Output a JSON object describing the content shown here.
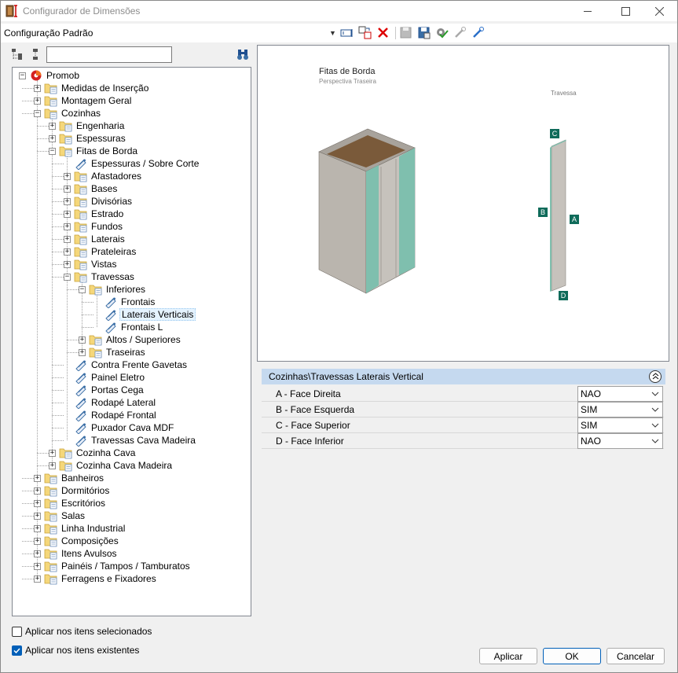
{
  "window": {
    "title": "Configurador de Dimensões"
  },
  "toolbar": {
    "configuration": "Configuração Padrão"
  },
  "search": {
    "value": ""
  },
  "tree": [
    {
      "label": "Promob",
      "depth": 0,
      "icon": "promob-icon",
      "expander": "minus"
    },
    {
      "label": "Medidas de Inserção",
      "depth": 1,
      "icon": "folder-icon",
      "expander": "plus"
    },
    {
      "label": "Montagem Geral",
      "depth": 1,
      "icon": "folder-icon",
      "expander": "plus"
    },
    {
      "label": "Cozinhas",
      "depth": 1,
      "icon": "folder-icon",
      "expander": "minus"
    },
    {
      "label": "Engenharia",
      "depth": 2,
      "icon": "folder-icon",
      "expander": "plus"
    },
    {
      "label": "Espessuras",
      "depth": 2,
      "icon": "folder-icon",
      "expander": "plus"
    },
    {
      "label": "Fitas de Borda",
      "depth": 2,
      "icon": "folder-icon",
      "expander": "minus"
    },
    {
      "label": "Espessuras / Sobre Corte",
      "depth": 3,
      "icon": "config-item-icon",
      "expander": "none"
    },
    {
      "label": "Afastadores",
      "depth": 3,
      "icon": "folder-icon",
      "expander": "plus"
    },
    {
      "label": "Bases",
      "depth": 3,
      "icon": "folder-icon",
      "expander": "plus"
    },
    {
      "label": "Divisórias",
      "depth": 3,
      "icon": "folder-icon",
      "expander": "plus"
    },
    {
      "label": "Estrado",
      "depth": 3,
      "icon": "folder-icon",
      "expander": "plus"
    },
    {
      "label": "Fundos",
      "depth": 3,
      "icon": "folder-icon",
      "expander": "plus"
    },
    {
      "label": "Laterais",
      "depth": 3,
      "icon": "folder-icon",
      "expander": "plus"
    },
    {
      "label": "Prateleiras",
      "depth": 3,
      "icon": "folder-icon",
      "expander": "plus"
    },
    {
      "label": "Vistas",
      "depth": 3,
      "icon": "folder-icon",
      "expander": "plus"
    },
    {
      "label": "Travessas",
      "depth": 3,
      "icon": "folder-icon",
      "expander": "minus"
    },
    {
      "label": "Inferiores",
      "depth": 4,
      "icon": "folder-icon",
      "expander": "minus"
    },
    {
      "label": "Frontais",
      "depth": 5,
      "icon": "config-item-icon",
      "expander": "none"
    },
    {
      "label": "Laterais Verticais",
      "depth": 5,
      "icon": "config-item-icon",
      "expander": "none",
      "selected": true
    },
    {
      "label": "Frontais L",
      "depth": 5,
      "icon": "config-item-icon",
      "expander": "none"
    },
    {
      "label": "Altos / Superiores",
      "depth": 4,
      "icon": "folder-icon",
      "expander": "plus"
    },
    {
      "label": "Traseiras",
      "depth": 4,
      "icon": "folder-icon",
      "expander": "plus"
    },
    {
      "label": "Contra Frente Gavetas",
      "depth": 3,
      "icon": "config-item-icon",
      "expander": "none"
    },
    {
      "label": "Painel Eletro",
      "depth": 3,
      "icon": "config-item-icon",
      "expander": "none"
    },
    {
      "label": "Portas Cega",
      "depth": 3,
      "icon": "config-item-icon",
      "expander": "none"
    },
    {
      "label": "Rodapé Lateral",
      "depth": 3,
      "icon": "config-item-icon",
      "expander": "none"
    },
    {
      "label": "Rodapé Frontal",
      "depth": 3,
      "icon": "config-item-icon",
      "expander": "none"
    },
    {
      "label": "Puxador Cava MDF",
      "depth": 3,
      "icon": "config-item-icon",
      "expander": "none"
    },
    {
      "label": "Travessas Cava Madeira",
      "depth": 3,
      "icon": "config-item-icon",
      "expander": "none"
    },
    {
      "label": "Cozinha Cava",
      "depth": 2,
      "icon": "folder-icon",
      "expander": "plus"
    },
    {
      "label": "Cozinha Cava Madeira",
      "depth": 2,
      "icon": "folder-icon",
      "expander": "plus"
    },
    {
      "label": "Banheiros",
      "depth": 1,
      "icon": "folder-icon",
      "expander": "plus"
    },
    {
      "label": "Dormitórios",
      "depth": 1,
      "icon": "folder-icon",
      "expander": "plus"
    },
    {
      "label": "Escritórios",
      "depth": 1,
      "icon": "folder-icon",
      "expander": "plus"
    },
    {
      "label": "Salas",
      "depth": 1,
      "icon": "folder-icon",
      "expander": "plus"
    },
    {
      "label": "Linha Industrial",
      "depth": 1,
      "icon": "folder-icon",
      "expander": "plus"
    },
    {
      "label": "Composições",
      "depth": 1,
      "icon": "folder-icon",
      "expander": "plus"
    },
    {
      "label": "Itens Avulsos",
      "depth": 1,
      "icon": "folder-icon",
      "expander": "plus"
    },
    {
      "label": "Painéis / Tampos / Tamburatos",
      "depth": 1,
      "icon": "folder-icon",
      "expander": "plus"
    },
    {
      "label": "Ferragens e Fixadores",
      "depth": 1,
      "icon": "folder-icon",
      "expander": "plus"
    }
  ],
  "preview": {
    "title": "Fitas de Borda",
    "subtitle": "Perspectiva Traseira",
    "part_label": "Travessa",
    "edge_labels": {
      "a": "A",
      "b": "B",
      "c": "C",
      "d": "D"
    },
    "edge_color": "#7fbfae",
    "tag_color": "#0f6b5a"
  },
  "properties": {
    "header": "Cozinhas\\Travessas Laterais Vertical",
    "rows": [
      {
        "name": "A - Face Direita",
        "value": "NAO"
      },
      {
        "name": "B - Face Esquerda",
        "value": "SIM"
      },
      {
        "name": "C - Face Superior",
        "value": "SIM"
      },
      {
        "name": "D - Face Inferior",
        "value": "NAO"
      }
    ]
  },
  "options": {
    "apply_selected": {
      "label": "Aplicar nos itens selecionados",
      "checked": false
    },
    "apply_existing": {
      "label": "Aplicar nos itens existentes",
      "checked": true
    }
  },
  "buttons": {
    "apply": "Aplicar",
    "ok": "OK",
    "cancel": "Cancelar"
  }
}
